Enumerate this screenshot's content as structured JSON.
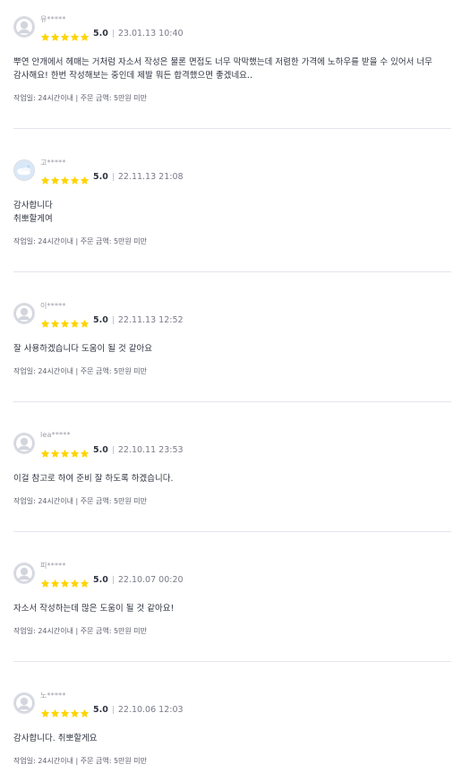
{
  "reviews": [
    {
      "name": "유*****",
      "score": "5.0",
      "date": "23.01.13 10:40",
      "rating": 5,
      "text": "뿌연 안개에서 헤매는 거처럼 자소서 작성은 물론 면접도 너무 막막했는데 저렴한 가격에 노하우를 받을 수 있어서 너무\n감사해요! 한번 작성해보는 중인데 제발 뭐든 합격했으면 좋겠네요..",
      "info": "작업일: 24시간이내 | 주문 금액: 5만원 미만",
      "avatar": "default"
    },
    {
      "name": "고*****",
      "score": "5.0",
      "date": "22.11.13 21:08",
      "rating": 5,
      "text": "감사합니다\n취뽀할게여",
      "info": "작업일: 24시간이내 | 주문 금액: 5만원 미만",
      "avatar": "photo"
    },
    {
      "name": "이*****",
      "score": "5.0",
      "date": "22.11.13 12:52",
      "rating": 5,
      "text": "잘 사용하겠습니다 도움이 될 것 같아요",
      "info": "작업일: 24시간이내 | 주문 금액: 5만원 미만",
      "avatar": "default"
    },
    {
      "name": "lea*****",
      "score": "5.0",
      "date": "22.10.11 23:53",
      "rating": 5,
      "text": "이걸 참고로 하여 준비 잘 하도록 하겠습니다.",
      "info": "작업일: 24시간이내 | 주문 금액: 5만원 미만",
      "avatar": "default"
    },
    {
      "name": "피*****",
      "score": "5.0",
      "date": "22.10.07 00:20",
      "rating": 5,
      "text": "자소서 작성하는데 많은 도움이 될 것 같아요!",
      "info": "작업일: 24시간이내 | 주문 금액: 5만원 미만",
      "avatar": "default"
    },
    {
      "name": "노*****",
      "score": "5.0",
      "date": "22.10.06 12:03",
      "rating": 5,
      "text": "감사합니다. 취뽀할게요",
      "info": "작업일: 24시간이내 | 주문 금액: 5만원 미만",
      "avatar": "default"
    }
  ],
  "colors": {
    "star": "#ffd400",
    "divider": "#e4e5ed"
  },
  "icons": {
    "star": "star-icon",
    "avatar_default": "default-user-avatar-icon",
    "avatar_photo": "user-photo-avatar"
  }
}
